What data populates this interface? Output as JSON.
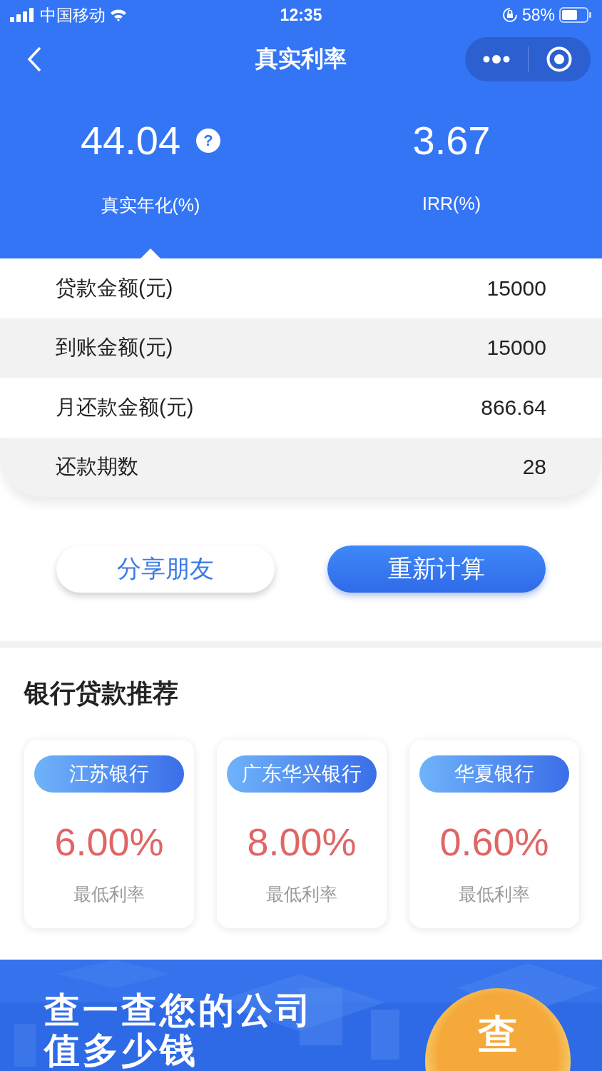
{
  "status_bar": {
    "carrier": "中国移动",
    "time": "12:35",
    "battery": "58%"
  },
  "nav": {
    "title": "真实利率"
  },
  "stats": [
    {
      "value": "44.04",
      "label": "真实年化(%)",
      "help": "?",
      "selected": true
    },
    {
      "value": "3.67",
      "label": "IRR(%)",
      "selected": false
    }
  ],
  "details": [
    {
      "label": "贷款金额(元)",
      "value": "15000"
    },
    {
      "label": "到账金额(元)",
      "value": "15000"
    },
    {
      "label": "月还款金额(元)",
      "value": "866.64"
    },
    {
      "label": "还款期数",
      "value": "28"
    }
  ],
  "buttons": [
    {
      "label": "分享朋友",
      "kind": "secondary"
    },
    {
      "label": "重新计算",
      "kind": "primary"
    }
  ],
  "recommend": {
    "title": "银行贷款推荐",
    "cards": [
      {
        "bank": "江苏银行",
        "rate": "6.00%",
        "caption": "最低利率"
      },
      {
        "bank": "广东华兴银行",
        "rate": "8.00%",
        "caption": "最低利率"
      },
      {
        "bank": "华夏银行",
        "rate": "0.60%",
        "caption": "最低利率"
      }
    ]
  },
  "banner": {
    "lines": [
      "查一查您的公司",
      "值多少钱"
    ],
    "badge": "查"
  }
}
